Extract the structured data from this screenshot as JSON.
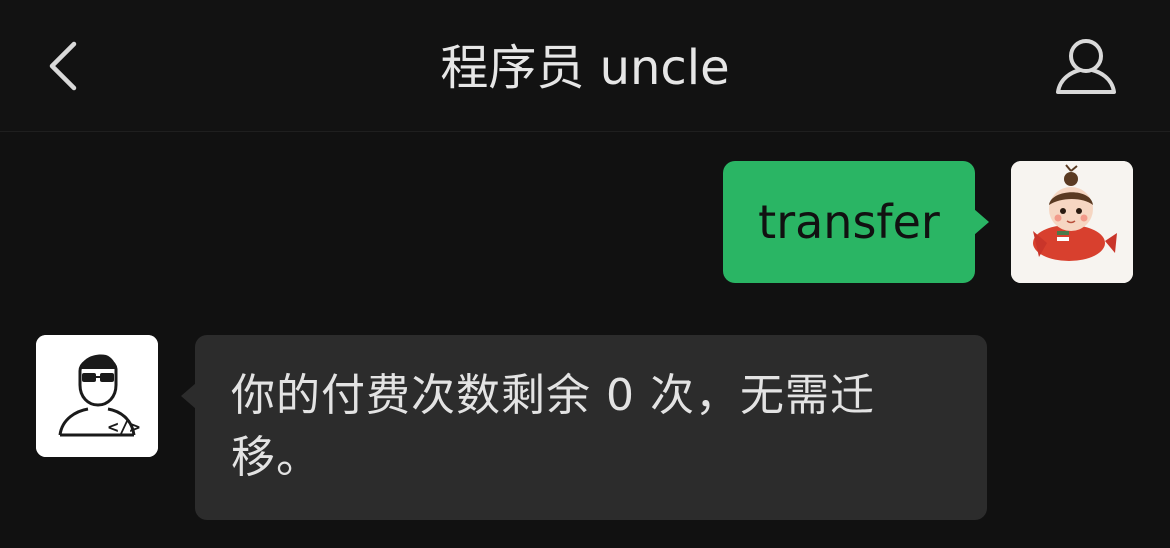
{
  "header": {
    "title": "程序员 uncle",
    "back_icon": "chevron-left-icon",
    "profile_icon": "person-outline-icon"
  },
  "messages": [
    {
      "direction": "outgoing",
      "text": "transfer",
      "avatar": "girl-cartoon-avatar"
    },
    {
      "direction": "incoming",
      "text": "你的付费次数剩余 0 次，无需迁移。",
      "avatar": "programmer-avatar"
    }
  ],
  "colors": {
    "background": "#111111",
    "outgoing_bubble": "#2ab564",
    "incoming_bubble": "#2c2c2c",
    "title_text": "#e6e6e6"
  }
}
